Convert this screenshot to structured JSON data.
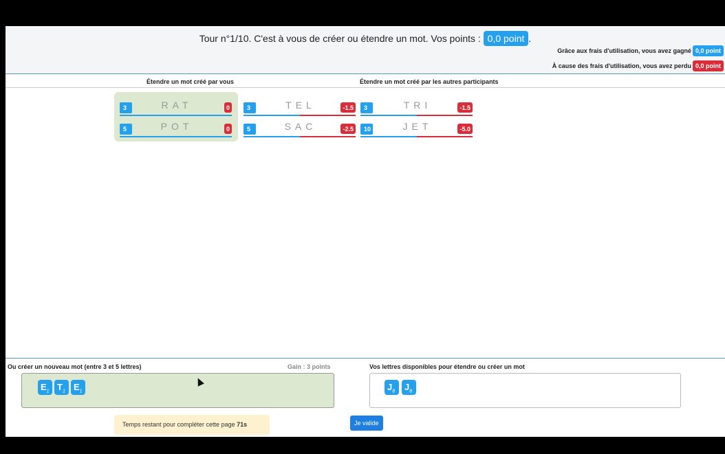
{
  "header": {
    "turn_text": "Tour n°1/10. C'est à vous de créer ou étendre un mot. Vos points :",
    "points": "0,0 point",
    "points_suffix": ".",
    "fee_gain_text": "Grâce aux frais d'utilisation, vous avez gagné",
    "fee_gain_value": "0,0 point",
    "fee_loss_text": "À cause des frais d'utilisation, vous avez perdu",
    "fee_loss_value": "0,0 point"
  },
  "sections": {
    "own_title": "Étendre un mot créé par vous",
    "others_title": "Étendre un mot créé par les autres participants"
  },
  "own_words": [
    {
      "count": "3",
      "letters": "RAT",
      "score": "0"
    },
    {
      "count": "5",
      "letters": "POT",
      "score": "0"
    }
  ],
  "other_words": [
    {
      "count": "3",
      "letters": "TEL",
      "score": "-1.5",
      "red_fraction": 0.5
    },
    {
      "count": "3",
      "letters": "TRI",
      "score": "-1.5",
      "red_fraction": 0.5
    },
    {
      "count": "5",
      "letters": "SAC",
      "score": "-2.5",
      "red_fraction": 0.5
    },
    {
      "count": "10",
      "letters": "JET",
      "score": "-5.0",
      "red_fraction": 0.5
    }
  ],
  "new_word": {
    "label": "Ou créer un nouveau mot (entre 3 et 5 lettres)",
    "gain": "Gain : 3 points",
    "tiles": [
      {
        "letter": "E",
        "value": "1"
      },
      {
        "letter": "T",
        "value": "1"
      },
      {
        "letter": "E",
        "value": "1"
      }
    ]
  },
  "available": {
    "label": "Vos lettres disponibles pour étendre ou créer un mot",
    "tiles": [
      {
        "letter": "J",
        "value": "8"
      },
      {
        "letter": "J",
        "value": "8"
      }
    ]
  },
  "timer": {
    "text": "Temps restant pour compléter cette page",
    "value": "71s"
  },
  "validate_label": "Je valide",
  "colors": {
    "accent": "#24a0ed",
    "danger": "#d92d3a",
    "panel_green": "#dce8cf",
    "timer_bg": "#fdf1d0"
  }
}
